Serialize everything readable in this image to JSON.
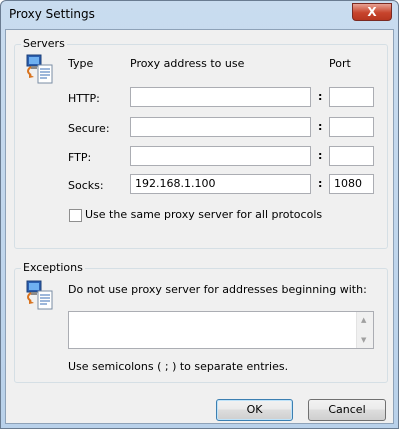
{
  "window": {
    "title": "Proxy Settings",
    "close_glyph": "X"
  },
  "servers": {
    "legend": "Servers",
    "col_type": "Type",
    "col_address": "Proxy address to use",
    "col_port": "Port",
    "rows": [
      {
        "label": "HTTP:",
        "address": "",
        "port": ""
      },
      {
        "label": "Secure:",
        "address": "",
        "port": ""
      },
      {
        "label": "FTP:",
        "address": "",
        "port": ""
      },
      {
        "label": "Socks:",
        "address": "192.168.1.100",
        "port": "1080"
      }
    ],
    "colon": ":",
    "same_proxy_label": "Use the same proxy server for all protocols",
    "same_proxy_checked": false,
    "icon": "network-computer-document-icon"
  },
  "exceptions": {
    "legend": "Exceptions",
    "instruction": "Do not use proxy server for addresses beginning with:",
    "value": "",
    "hint": "Use semicolons ( ; ) to separate entries.",
    "icon": "network-computer-document-icon"
  },
  "buttons": {
    "ok": "OK",
    "cancel": "Cancel"
  }
}
